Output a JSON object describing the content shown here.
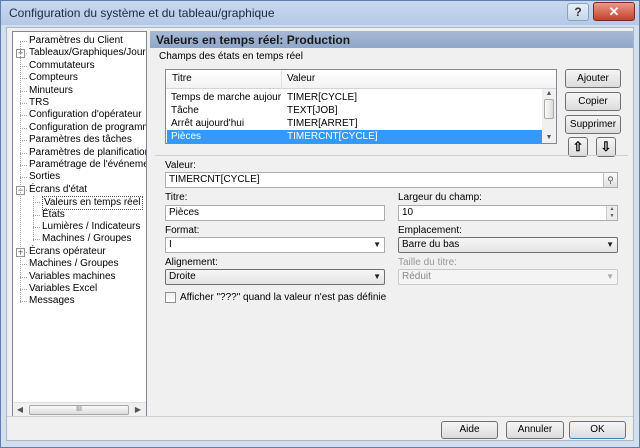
{
  "window": {
    "title": "Configuration du système et du tableau/graphique",
    "help_label": "?",
    "close_label": "✕"
  },
  "tree": {
    "items": [
      {
        "label": "Paramètres du Client"
      },
      {
        "label": "Tableaux/Graphiques/Journal",
        "expander": "+"
      },
      {
        "label": "Commutateurs"
      },
      {
        "label": "Compteurs"
      },
      {
        "label": "Minuteurs"
      },
      {
        "label": "TRS"
      },
      {
        "label": "Configuration d'opérateur"
      },
      {
        "label": "Configuration de programme"
      },
      {
        "label": "Paramètres des tâches"
      },
      {
        "label": "Paramètres de planification"
      },
      {
        "label": "Paramétrage de l'événement"
      },
      {
        "label": "Sorties"
      },
      {
        "label": "Écrans d'état",
        "expander": "−"
      },
      {
        "label": "Valeurs en temps réel",
        "selected": true
      },
      {
        "label": "États"
      },
      {
        "label": "Lumières / Indicateurs"
      },
      {
        "label": "Machines / Groupes"
      },
      {
        "label": "Écrans opérateur",
        "expander": "+"
      },
      {
        "label": "Machines / Groupes"
      },
      {
        "label": "Variables machines"
      },
      {
        "label": "Variables Excel"
      },
      {
        "label": "Messages"
      }
    ],
    "scroll_thumb": "III"
  },
  "panel": {
    "title": "Valeurs en temps réel: Production",
    "fields_label": "Champs des états en temps réel"
  },
  "table": {
    "columns": [
      "Titre",
      "Valeur"
    ],
    "rows": [
      {
        "title": "Temps de marche aujourd'hui",
        "value": "TIMER[CYCLE]"
      },
      {
        "title": "Tâche",
        "value": "TEXT[JOB]"
      },
      {
        "title": "Arrêt aujourd'hui",
        "value": "TIMER[ARRET]"
      },
      {
        "title": "Pièces",
        "value": "TIMERCNT[CYCLE]",
        "selected": true
      }
    ]
  },
  "buttons": {
    "add": "Ajouter",
    "copy": "Copier",
    "delete": "Supprimer",
    "move_up": "⇧",
    "move_down": "⇩"
  },
  "form": {
    "value_label": "Valeur:",
    "value": "TIMERCNT[CYCLE]",
    "title_label": "Titre:",
    "title_value": "Pièces",
    "width_label": "Largeur du champ:",
    "width_value": "10",
    "format_label": "Format:",
    "format_value": "I",
    "location_label": "Emplacement:",
    "location_value": "Barre du bas",
    "alignment_label": "Alignement:",
    "alignment_value": "Droite",
    "title_size_label": "Taille du titre:",
    "title_size_value": "Réduit",
    "show_undefined_label": "Afficher \"???\" quand la valeur n'est pas définie",
    "show_undefined_checked": false
  },
  "footer": {
    "help": "Aide",
    "cancel": "Annuler",
    "ok": "OK"
  }
}
